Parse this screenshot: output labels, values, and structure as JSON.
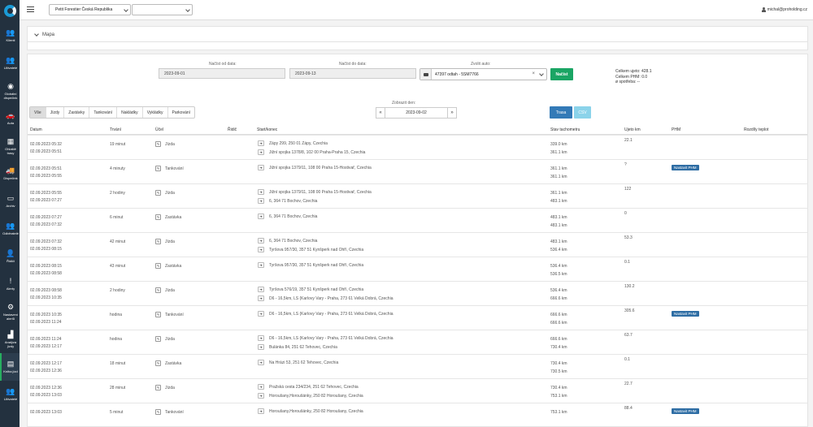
{
  "sidebar": {
    "items": [
      {
        "label": "Klienti",
        "icon": "users-icon"
      },
      {
        "label": "Uživatelé",
        "icon": "user-group-icon"
      },
      {
        "label": "Globální dispečink",
        "icon": "globe-icon"
      },
      {
        "label": "Auta",
        "icon": "car-icon"
      },
      {
        "label": "Ohlaště trasy",
        "icon": "grid-icon"
      },
      {
        "label": "Dispečink",
        "icon": "truck-icon"
      },
      {
        "label": "Archiv",
        "icon": "archive-icon"
      },
      {
        "label": "Odběratelé",
        "icon": "customers-icon"
      },
      {
        "label": "Řidiči",
        "icon": "driver-icon"
      },
      {
        "label": "Alerty",
        "icon": "alert-icon"
      },
      {
        "label": "Nastavení alertů",
        "icon": "alert-settings-icon"
      },
      {
        "label": "Analýza jízdy",
        "icon": "analytics-icon"
      },
      {
        "label": "Kniha jízd",
        "icon": "logbook-icon"
      },
      {
        "label": "Uživatelé",
        "icon": "users-settings-icon"
      }
    ],
    "active_index": 12
  },
  "topbar": {
    "company_select": "Petit Forestier Česká Republika",
    "second_select": "",
    "user_email": "michal@proholding.cz"
  },
  "map_panel": {
    "label": "Mapa"
  },
  "filters": {
    "from_label": "Načíst od data:",
    "from_value": "2023-09-01",
    "to_label": "Načíst do data:",
    "to_value": "2023-09-13",
    "car_label": "Zvolit auto:",
    "car_value": "47397 odtah - 5SM7766",
    "car_clear": "×",
    "load_button": "Načíst",
    "total_distance": "Celkem ujeto: 428.1",
    "total_fuel": "Celkem PHM: 0.0",
    "avg_consumption": "ø spotřeba: --"
  },
  "tabs": [
    "Vše",
    "Jízdy",
    "Zastávky",
    "Tankování",
    "Nakládky",
    "Vykládky",
    "Parkování"
  ],
  "active_tab": 0,
  "day": {
    "label": "Zobrazit den:",
    "value": "2023-09-02",
    "prev": "«",
    "next": "»"
  },
  "actions": {
    "route": "Trasa",
    "csv": "CSV"
  },
  "table": {
    "headers": {
      "date": "Datum",
      "duration": "Trvání",
      "purpose": "Účel",
      "driver": "Řidič",
      "route": "Start/konec",
      "odometer": "Stav tachometru",
      "distance": "Ujeto km",
      "fuel": "PHM",
      "temp": "Rozdíly teplot"
    },
    "fuel_button": "Nastavit PHM",
    "rows": [
      {
        "start": "02.09.2023 05:32",
        "end": "02.09.2023 05:51",
        "duration": "19 minut",
        "purpose": "Jízda",
        "from": "Zápy 299, 250 01 Zápy, Czechia",
        "to": "Jižní spojka 1378/8, 102 00 Praha-Praha 15, Czechia",
        "odo_start": "339.0 km",
        "odo_end": "361.1 km",
        "distance": "22.1",
        "fuel": false
      },
      {
        "start": "02.09.2023 05:51",
        "end": "02.09.2023 05:55",
        "duration": "4 minuty",
        "purpose": "Tankování",
        "from": "Jižní spojka 1379/11, 108 00 Praha 15-Hostivař, Czechia",
        "to": "",
        "odo_start": "361.1 km",
        "odo_end": "361.1 km",
        "distance": "?",
        "fuel": true
      },
      {
        "start": "02.09.2023 05:55",
        "end": "02.09.2023 07:27",
        "duration": "2 hodiny",
        "purpose": "Jízda",
        "from": "Jižní spojka 1379/11, 108 00 Praha 15-Hostivař, Czechia",
        "to": "6, 364 71 Bochov, Czechia",
        "odo_start": "361.1 km",
        "odo_end": "483.1 km",
        "distance": "122",
        "fuel": false
      },
      {
        "start": "02.09.2023 07:27",
        "end": "02.09.2023 07:32",
        "duration": "6 minut",
        "purpose": "Zastávka",
        "from": "6, 364 71 Bochov, Czechia",
        "to": "",
        "odo_start": "483.1 km",
        "odo_end": "483.1 km",
        "distance": "0",
        "fuel": false
      },
      {
        "start": "02.09.2023 07:32",
        "end": "02.09.2023 08:15",
        "duration": "42 minut",
        "purpose": "Jízda",
        "from": "6, 364 71 Bochov, Czechia",
        "to": "Tyršova 957/30, 357 51 Kynšperk nad Ohří, Czechia",
        "odo_start": "483.1 km",
        "odo_end": "536.4 km",
        "distance": "53.3",
        "fuel": false
      },
      {
        "start": "02.09.2023 08:15",
        "end": "02.09.2023 08:58",
        "duration": "43 minut",
        "purpose": "Zastávka",
        "from": "Tyršova 957/30, 357 51 Kynšperk nad Ohří, Czechia",
        "to": "",
        "odo_start": "536.4 km",
        "odo_end": "536.5 km",
        "distance": "0.1",
        "fuel": false
      },
      {
        "start": "02.09.2023 08:58",
        "end": "02.09.2023 10:35",
        "duration": "2 hodiny",
        "purpose": "Jízda",
        "from": "Tyršova 576/19, 357 51 Kynšperk nad Ohří, Czechia",
        "to": "D6 - 16,5km, LS (Karlovy Vary - Praha, 273 61 Velká Dobrá, Czechia",
        "odo_start": "536.4 km",
        "odo_end": "666.6 km",
        "distance": "130.2",
        "fuel": false
      },
      {
        "start": "02.09.2023 10:35",
        "end": "02.09.2023 11:24",
        "duration": "hodina",
        "purpose": "Tankování",
        "from": "D6 - 16,5km, LS (Karlovy Vary - Praha, 273 61 Velká Dobrá, Czechia",
        "to": "",
        "odo_start": "666.6 km",
        "odo_end": "666.6 km",
        "distance": "305.6",
        "fuel": true
      },
      {
        "start": "02.09.2023 11:24",
        "end": "02.09.2023 12:17",
        "duration": "hodina",
        "purpose": "Jízda",
        "from": "D6 - 16,5km, LS (Karlovy Vary - Praha, 273 61 Velká Dobrá, Czechia",
        "to": "Bulánka 84, 251 62 Tehovec, Czechia",
        "odo_start": "666.6 km",
        "odo_end": "730.4 km",
        "distance": "63.7",
        "fuel": false
      },
      {
        "start": "02.09.2023 12:17",
        "end": "02.09.2023 12:36",
        "duration": "18 minut",
        "purpose": "Zastávka",
        "from": "Na Hrázi 53, 251 62 Tehovec, Czechia",
        "to": "",
        "odo_start": "730.4 km",
        "odo_end": "730.5 km",
        "distance": "0.1",
        "fuel": false
      },
      {
        "start": "02.09.2023 12:36",
        "end": "02.09.2023 13:03",
        "duration": "28 minut",
        "purpose": "Jízda",
        "from": "Pražská cesta 234/234, 251 62 Tehovec, Czechia",
        "to": "Horoušany,Horoušánky, 250 82 Horoušany, Czechia",
        "odo_start": "730.4 km",
        "odo_end": "753.1 km",
        "distance": "22.7",
        "fuel": false
      },
      {
        "start": "02.09.2023 13:03",
        "end": "",
        "duration": "5 minut",
        "purpose": "Tankování",
        "from": "Horoušany,Horoušánky, 250 82 Horoušany, Czechia",
        "to": "",
        "odo_start": "753.1 km",
        "odo_end": "",
        "distance": "88.4",
        "fuel": true
      }
    ]
  }
}
